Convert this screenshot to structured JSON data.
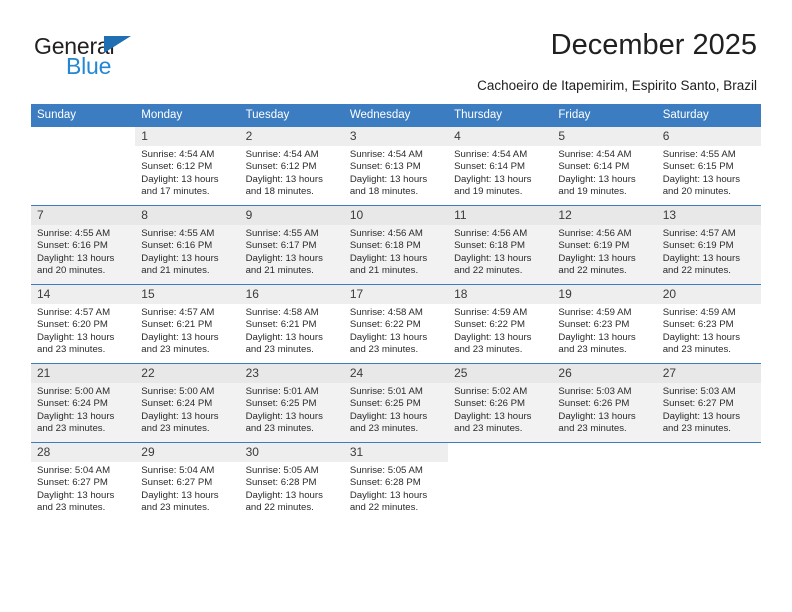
{
  "brand": {
    "name_part1": "General",
    "name_part2": "Blue",
    "accent_color": "#2387d4",
    "triangle_color": "#1f6fb2"
  },
  "header": {
    "title": "December 2025",
    "subtitle": "Cachoeiro de Itapemirim, Espirito Santo, Brazil"
  },
  "calendar": {
    "header_bg": "#3b7dc0",
    "weekdays": [
      "Sunday",
      "Monday",
      "Tuesday",
      "Wednesday",
      "Thursday",
      "Friday",
      "Saturday"
    ],
    "weeks": [
      [
        {
          "day": "",
          "sunrise": "",
          "sunset": "",
          "daylight1": "",
          "daylight2": ""
        },
        {
          "day": "1",
          "sunrise": "Sunrise: 4:54 AM",
          "sunset": "Sunset: 6:12 PM",
          "daylight1": "Daylight: 13 hours",
          "daylight2": "and 17 minutes."
        },
        {
          "day": "2",
          "sunrise": "Sunrise: 4:54 AM",
          "sunset": "Sunset: 6:12 PM",
          "daylight1": "Daylight: 13 hours",
          "daylight2": "and 18 minutes."
        },
        {
          "day": "3",
          "sunrise": "Sunrise: 4:54 AM",
          "sunset": "Sunset: 6:13 PM",
          "daylight1": "Daylight: 13 hours",
          "daylight2": "and 18 minutes."
        },
        {
          "day": "4",
          "sunrise": "Sunrise: 4:54 AM",
          "sunset": "Sunset: 6:14 PM",
          "daylight1": "Daylight: 13 hours",
          "daylight2": "and 19 minutes."
        },
        {
          "day": "5",
          "sunrise": "Sunrise: 4:54 AM",
          "sunset": "Sunset: 6:14 PM",
          "daylight1": "Daylight: 13 hours",
          "daylight2": "and 19 minutes."
        },
        {
          "day": "6",
          "sunrise": "Sunrise: 4:55 AM",
          "sunset": "Sunset: 6:15 PM",
          "daylight1": "Daylight: 13 hours",
          "daylight2": "and 20 minutes."
        }
      ],
      [
        {
          "day": "7",
          "sunrise": "Sunrise: 4:55 AM",
          "sunset": "Sunset: 6:16 PM",
          "daylight1": "Daylight: 13 hours",
          "daylight2": "and 20 minutes."
        },
        {
          "day": "8",
          "sunrise": "Sunrise: 4:55 AM",
          "sunset": "Sunset: 6:16 PM",
          "daylight1": "Daylight: 13 hours",
          "daylight2": "and 21 minutes."
        },
        {
          "day": "9",
          "sunrise": "Sunrise: 4:55 AM",
          "sunset": "Sunset: 6:17 PM",
          "daylight1": "Daylight: 13 hours",
          "daylight2": "and 21 minutes."
        },
        {
          "day": "10",
          "sunrise": "Sunrise: 4:56 AM",
          "sunset": "Sunset: 6:18 PM",
          "daylight1": "Daylight: 13 hours",
          "daylight2": "and 21 minutes."
        },
        {
          "day": "11",
          "sunrise": "Sunrise: 4:56 AM",
          "sunset": "Sunset: 6:18 PM",
          "daylight1": "Daylight: 13 hours",
          "daylight2": "and 22 minutes."
        },
        {
          "day": "12",
          "sunrise": "Sunrise: 4:56 AM",
          "sunset": "Sunset: 6:19 PM",
          "daylight1": "Daylight: 13 hours",
          "daylight2": "and 22 minutes."
        },
        {
          "day": "13",
          "sunrise": "Sunrise: 4:57 AM",
          "sunset": "Sunset: 6:19 PM",
          "daylight1": "Daylight: 13 hours",
          "daylight2": "and 22 minutes."
        }
      ],
      [
        {
          "day": "14",
          "sunrise": "Sunrise: 4:57 AM",
          "sunset": "Sunset: 6:20 PM",
          "daylight1": "Daylight: 13 hours",
          "daylight2": "and 23 minutes."
        },
        {
          "day": "15",
          "sunrise": "Sunrise: 4:57 AM",
          "sunset": "Sunset: 6:21 PM",
          "daylight1": "Daylight: 13 hours",
          "daylight2": "and 23 minutes."
        },
        {
          "day": "16",
          "sunrise": "Sunrise: 4:58 AM",
          "sunset": "Sunset: 6:21 PM",
          "daylight1": "Daylight: 13 hours",
          "daylight2": "and 23 minutes."
        },
        {
          "day": "17",
          "sunrise": "Sunrise: 4:58 AM",
          "sunset": "Sunset: 6:22 PM",
          "daylight1": "Daylight: 13 hours",
          "daylight2": "and 23 minutes."
        },
        {
          "day": "18",
          "sunrise": "Sunrise: 4:59 AM",
          "sunset": "Sunset: 6:22 PM",
          "daylight1": "Daylight: 13 hours",
          "daylight2": "and 23 minutes."
        },
        {
          "day": "19",
          "sunrise": "Sunrise: 4:59 AM",
          "sunset": "Sunset: 6:23 PM",
          "daylight1": "Daylight: 13 hours",
          "daylight2": "and 23 minutes."
        },
        {
          "day": "20",
          "sunrise": "Sunrise: 4:59 AM",
          "sunset": "Sunset: 6:23 PM",
          "daylight1": "Daylight: 13 hours",
          "daylight2": "and 23 minutes."
        }
      ],
      [
        {
          "day": "21",
          "sunrise": "Sunrise: 5:00 AM",
          "sunset": "Sunset: 6:24 PM",
          "daylight1": "Daylight: 13 hours",
          "daylight2": "and 23 minutes."
        },
        {
          "day": "22",
          "sunrise": "Sunrise: 5:00 AM",
          "sunset": "Sunset: 6:24 PM",
          "daylight1": "Daylight: 13 hours",
          "daylight2": "and 23 minutes."
        },
        {
          "day": "23",
          "sunrise": "Sunrise: 5:01 AM",
          "sunset": "Sunset: 6:25 PM",
          "daylight1": "Daylight: 13 hours",
          "daylight2": "and 23 minutes."
        },
        {
          "day": "24",
          "sunrise": "Sunrise: 5:01 AM",
          "sunset": "Sunset: 6:25 PM",
          "daylight1": "Daylight: 13 hours",
          "daylight2": "and 23 minutes."
        },
        {
          "day": "25",
          "sunrise": "Sunrise: 5:02 AM",
          "sunset": "Sunset: 6:26 PM",
          "daylight1": "Daylight: 13 hours",
          "daylight2": "and 23 minutes."
        },
        {
          "day": "26",
          "sunrise": "Sunrise: 5:03 AM",
          "sunset": "Sunset: 6:26 PM",
          "daylight1": "Daylight: 13 hours",
          "daylight2": "and 23 minutes."
        },
        {
          "day": "27",
          "sunrise": "Sunrise: 5:03 AM",
          "sunset": "Sunset: 6:27 PM",
          "daylight1": "Daylight: 13 hours",
          "daylight2": "and 23 minutes."
        }
      ],
      [
        {
          "day": "28",
          "sunrise": "Sunrise: 5:04 AM",
          "sunset": "Sunset: 6:27 PM",
          "daylight1": "Daylight: 13 hours",
          "daylight2": "and 23 minutes."
        },
        {
          "day": "29",
          "sunrise": "Sunrise: 5:04 AM",
          "sunset": "Sunset: 6:27 PM",
          "daylight1": "Daylight: 13 hours",
          "daylight2": "and 23 minutes."
        },
        {
          "day": "30",
          "sunrise": "Sunrise: 5:05 AM",
          "sunset": "Sunset: 6:28 PM",
          "daylight1": "Daylight: 13 hours",
          "daylight2": "and 22 minutes."
        },
        {
          "day": "31",
          "sunrise": "Sunrise: 5:05 AM",
          "sunset": "Sunset: 6:28 PM",
          "daylight1": "Daylight: 13 hours",
          "daylight2": "and 22 minutes."
        },
        {
          "day": "",
          "sunrise": "",
          "sunset": "",
          "daylight1": "",
          "daylight2": ""
        },
        {
          "day": "",
          "sunrise": "",
          "sunset": "",
          "daylight1": "",
          "daylight2": ""
        },
        {
          "day": "",
          "sunrise": "",
          "sunset": "",
          "daylight1": "",
          "daylight2": ""
        }
      ]
    ]
  }
}
